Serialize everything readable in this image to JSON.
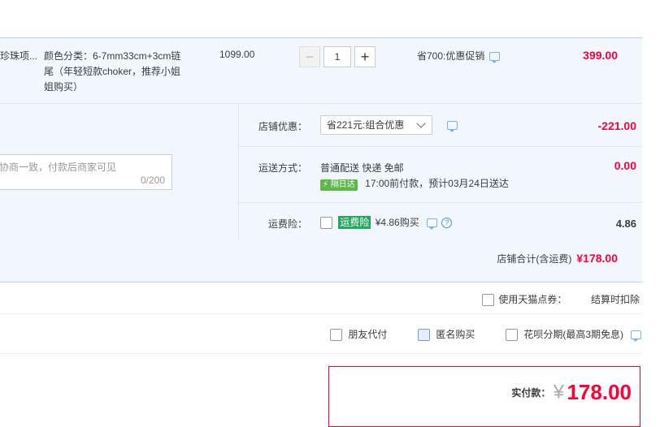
{
  "item": {
    "title": "珍珠项...",
    "sku_label": "颜色分类：6-7mm33cm+3cm链尾（年轻短款choker，推荐小姐姐购买）",
    "unit_price": "1099.00",
    "quantity": "1",
    "minus": "−",
    "plus": "+",
    "promo": "省700:优惠促销",
    "subtotal": "399.00"
  },
  "shop": {
    "memo_placeholder": "协商一致，付款后商家可见",
    "memo_count": "0/200",
    "discount_label": "店铺优惠：",
    "discount_select": "省221元:组合优惠",
    "discount_value": "-221.00",
    "shipping_label": "运送方式：",
    "shipping_method": "普通配送 快递 免邮",
    "shipping_tag": "隔日达",
    "shipping_eta": "17:00前付款，预计03月24日送达",
    "shipping_value": "0.00",
    "insurance_label": "运费险：",
    "insurance_tag": "运费险",
    "insurance_price": "¥4.86购买",
    "insurance_value": "4.86",
    "total_label": "店铺合计(含运费)",
    "total_value": "¥178.00"
  },
  "options": {
    "tmall_points": "使用天猫点券：",
    "tmall_points_note": "结算时扣除",
    "friend_pay": "朋友代付",
    "anonymous": "匿名购买",
    "huabei": "花呗分期(最高3期免息)"
  },
  "pay": {
    "label": "实付款：",
    "currency": "¥",
    "amount": "178.00"
  },
  "colors": {
    "accent": "#ff0036",
    "panel": "#f2f7ff",
    "border": "#b2d1ff"
  }
}
